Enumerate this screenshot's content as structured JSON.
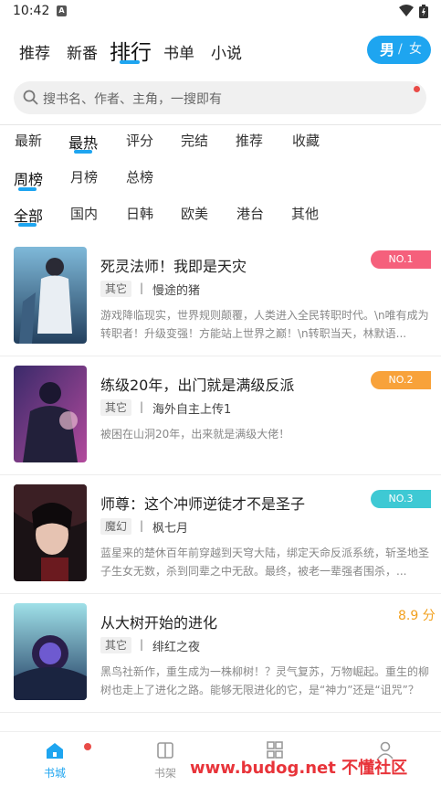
{
  "status": {
    "time": "10:42"
  },
  "top_tabs": [
    "推荐",
    "新番",
    "排行",
    "书单",
    "小说"
  ],
  "gender": {
    "male": "男",
    "sep": "/",
    "female": "女"
  },
  "search": {
    "placeholder": "搜书名、作者、主角，一搜即有"
  },
  "sort_filters": [
    "最新",
    "最热",
    "评分",
    "完结",
    "推荐",
    "收藏"
  ],
  "period_filters": [
    "周榜",
    "月榜",
    "总榜"
  ],
  "region_filters": [
    "全部",
    "国内",
    "日韩",
    "欧美",
    "港台",
    "其他"
  ],
  "books": [
    {
      "title": "死灵法师！我即是天灾",
      "tag": "其它",
      "author": "慢途的猪",
      "desc": "游戏降临现实，世界规则颠覆，人类进入全民转职时代。\\n唯有成为转职者！升级变强！方能站上世界之巅！\\n转职当天，林默语...",
      "badge": "NO.1",
      "badge_color": "#f5607c"
    },
    {
      "title": "练级20年，出门就是满级反派",
      "tag": "其它",
      "author": "海外自主上传1",
      "desc": "被困在山洞20年，出来就是满级大佬！",
      "badge": "NO.2",
      "badge_color": "#f8a23a"
    },
    {
      "title": "师尊：这个冲师逆徒才不是圣子",
      "tag": "魔幻",
      "author": "枫七月",
      "desc": "蓝星来的楚休百年前穿越到天穹大陆，绑定天命反派系统，斩圣地圣子生女无数，杀到同辈之中无敌。最终，被老一辈强者围杀，...",
      "badge": "NO.3",
      "badge_color": "#3ec9d4"
    },
    {
      "title": "从大树开始的进化",
      "tag": "其它",
      "author": "绯红之夜",
      "desc": "黑鸟社新作，重生成为一株柳树！？灵气复苏，万物崛起。重生的柳树也走上了进化之路。能够无限进化的它，是“神力”还是“诅咒”？",
      "score": "8.9 分"
    }
  ],
  "bottom_nav": [
    "书城",
    "书架",
    "",
    ""
  ],
  "watermark": "www.budog.net 不懂社区"
}
